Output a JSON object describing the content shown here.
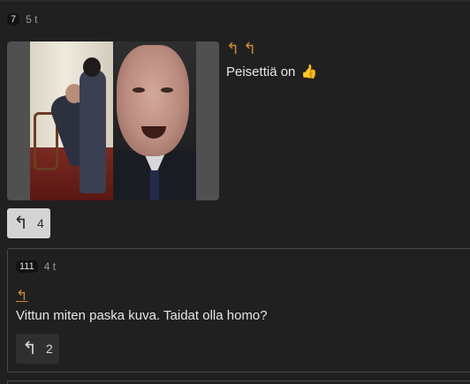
{
  "post": {
    "id_badge": "7",
    "time": "5 t",
    "reply_links": [
      "↰",
      "↰"
    ],
    "text": "Peisettiä on",
    "emoji": "👍",
    "reply_count": "4"
  },
  "reply": {
    "id_badge": "111",
    "time": "4 t",
    "quote_link": "↰",
    "text": "Vittun miten paska kuva. Taidat olla homo?",
    "reply_count": "2"
  },
  "colors": {
    "background": "#202020",
    "accent_link": "#c98a3a",
    "text": "#e6e6e6"
  },
  "icons": {
    "reply_arrow": "reply-arrow-icon"
  }
}
